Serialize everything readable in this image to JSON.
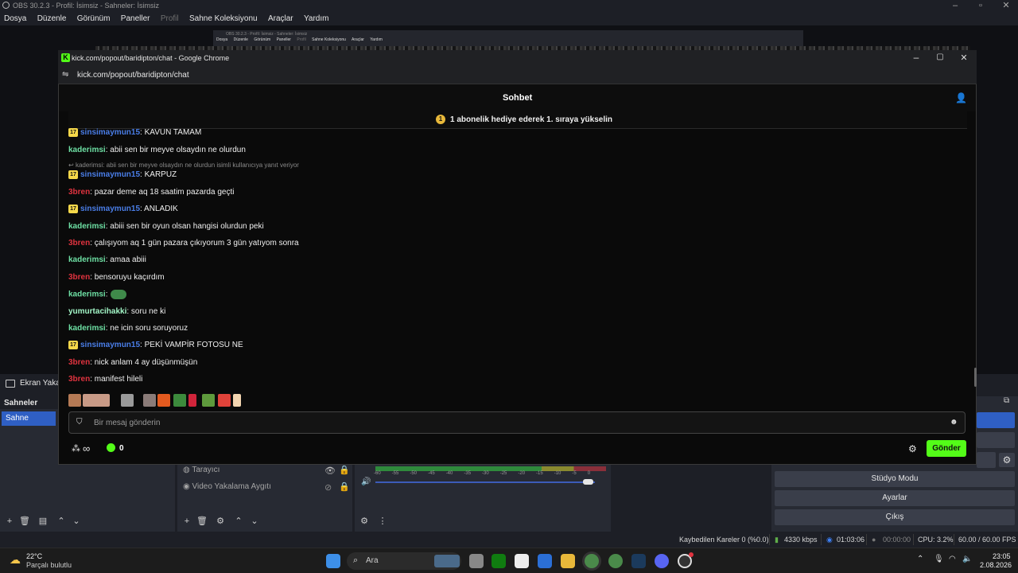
{
  "obs": {
    "title": "OBS 30.2.3 - Profil: İsimsiz - Sahneler: İsimsiz",
    "menu": [
      "Dosya",
      "Düzenle",
      "Görünüm",
      "Paneller",
      "Profil",
      "Sahne Koleksiyonu",
      "Araçlar",
      "Yardım"
    ],
    "nested_title": "OBS 30.2.3 - Profil: İsimsiz - Sahneler: İsimsiz",
    "nested_menu": [
      "Dosya",
      "Düzenle",
      "Görünüm",
      "Paneller",
      "Profil",
      "Sahne Koleksiyonu",
      "Araçlar",
      "Yardım"
    ],
    "source_bar_label": "Ekran Yakala",
    "scenes_header": "Sahneler",
    "scene_item": "Sahne",
    "sources": [
      "Tarayıcı",
      "Video Yakalama Aygıtı"
    ],
    "vu_ticks": [
      "-60",
      "-55",
      "-50",
      "-45",
      "-40",
      "-35",
      "-30",
      "-25",
      "-20",
      "-15",
      "-10",
      "-5",
      "0"
    ],
    "controls": [
      "Stüdyo Modu",
      "Ayarlar",
      "Çıkış"
    ],
    "status": {
      "dropped": "Kaybedilen Kareler 0 (%0.0)",
      "bitrate": "4330 kbps",
      "stream_time": "01:03:06",
      "rec_time": "00:00:00",
      "cpu": "CPU: 3.2%",
      "fps": "60.00 / 60.00 FPS"
    }
  },
  "chrome": {
    "title": "kick.com/popout/baridipton/chat - Google Chrome",
    "url": "kick.com/popout/baridipton/chat"
  },
  "chat": {
    "header": "Sohbet",
    "pinned": "1 abonelik hediye ederek 1. sıraya yükselin",
    "badge_text": "17",
    "reply_text": "kaderimsi: abii sen bir meyve olsaydın ne olurdun isimli kullanıcıya yanıt veriyor",
    "messages": [
      {
        "user": "sinsimaymun15",
        "text": ": KAVUN TAMAM"
      },
      {
        "user": "kaderimsi",
        "text": ": abii sen bir meyve olsaydın ne olurdun"
      },
      {
        "user": "sinsimaymun15",
        "text": ": KARPUZ"
      },
      {
        "user": "3bren",
        "text": ": pazar deme aq 18 saatim pazarda geçti"
      },
      {
        "user": "sinsimaymun15",
        "text": ": ANLADIK"
      },
      {
        "user": "kaderimsi",
        "text": ": abiii sen bir oyun olsan hangisi olurdun peki"
      },
      {
        "user": "3bren",
        "text": ": çalışıyom aq 1 gün pazara çıkıyorum 3 gün yatıyom sonra"
      },
      {
        "user": "kaderimsi",
        "text": ": amaa abiii"
      },
      {
        "user": "3bren",
        "text": ": bensoruyu kaçırdım"
      },
      {
        "user": "kaderimsi",
        "text": ":"
      },
      {
        "user": "yumurtacihakki",
        "text": ": soru ne ki"
      },
      {
        "user": "kaderimsi",
        "text": ": ne icin soru soruyoruz"
      },
      {
        "user": "sinsimaymun15",
        "text": ": PEKİ VAMPİR FOTOSU NE"
      },
      {
        "user": "3bren",
        "text": ": nick anlam 4 ay düşünmüşün"
      },
      {
        "user": "3bren",
        "text": ": manifest hileli"
      }
    ],
    "input_placeholder": "Bir mesaj gönderin",
    "infinity": "∞",
    "points": "0",
    "send": "Gönder"
  },
  "taskbar": {
    "weather_temp": "22°C",
    "weather_desc": "Parçalı bulutlu",
    "search": "Ara",
    "time": "23:05",
    "date": "2.08.2026"
  },
  "colors": {
    "kick_green": "#53fc18",
    "user_blue": "#4a7ee8",
    "user_green": "#6ee0a4",
    "user_red": "#e0333f",
    "user_lightgreen": "#a2f5c6",
    "scene_selected": "#2f5fc4"
  }
}
